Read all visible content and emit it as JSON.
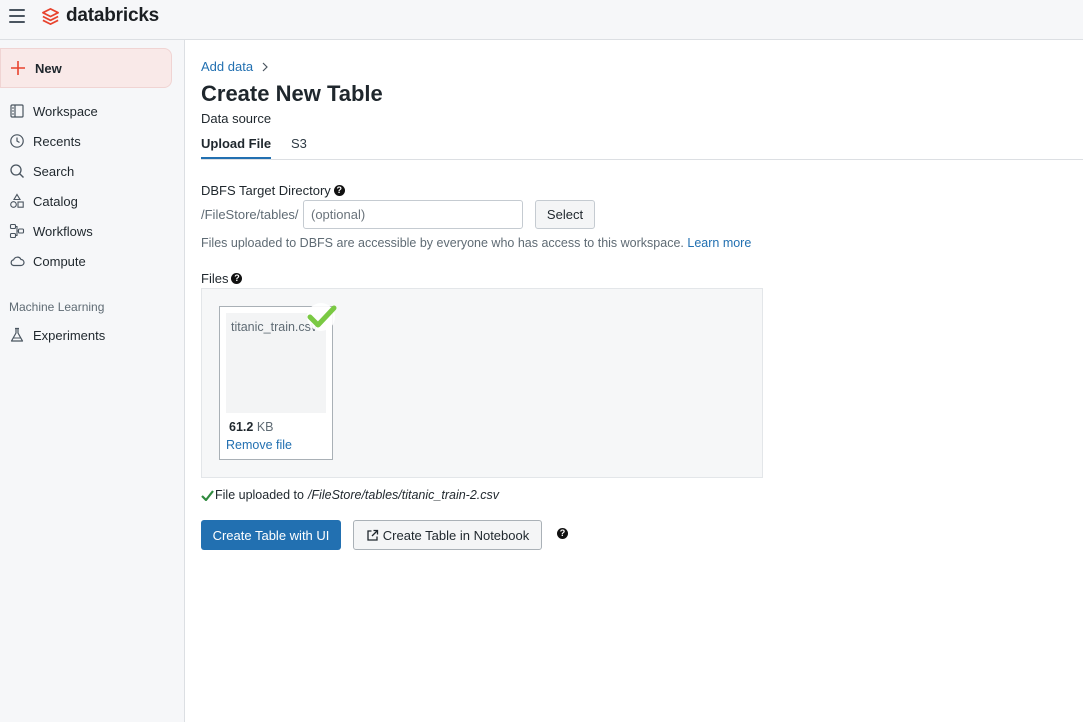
{
  "topbar": {
    "logo_text": "databricks"
  },
  "sidebar": {
    "new_label": "New",
    "items": [
      {
        "label": "Workspace",
        "icon": "workspace-icon"
      },
      {
        "label": "Recents",
        "icon": "clock-icon"
      },
      {
        "label": "Search",
        "icon": "search-icon"
      },
      {
        "label": "Catalog",
        "icon": "catalog-icon"
      },
      {
        "label": "Workflows",
        "icon": "workflows-icon"
      },
      {
        "label": "Compute",
        "icon": "cloud-icon"
      }
    ],
    "section_ml": "Machine Learning",
    "ml_items": [
      {
        "label": "Experiments",
        "icon": "flask-icon"
      }
    ]
  },
  "main": {
    "breadcrumb": "Add data",
    "title": "Create New Table",
    "data_source_label": "Data source",
    "tabs": [
      {
        "label": "Upload File",
        "active": true
      },
      {
        "label": "S3",
        "active": false
      }
    ],
    "dbfs": {
      "label": "DBFS Target Directory",
      "prefix": "/FileStore/tables/",
      "placeholder": "(optional)",
      "select_label": "Select",
      "info_text": "Files uploaded to DBFS are accessible by everyone who has access to this workspace.",
      "learn_more": "Learn more"
    },
    "files": {
      "label": "Files",
      "file_name": "titanic_train.csv",
      "size_value": "61.2",
      "size_unit": "KB",
      "remove_label": "Remove file"
    },
    "upload_status": {
      "prefix": "File uploaded to",
      "path": "/FileStore/tables/titanic_train-2.csv"
    },
    "buttons": {
      "create_ui": "Create Table with UI",
      "create_notebook": "Create Table in Notebook"
    },
    "help_glyph": "?"
  },
  "colors": {
    "accent": "#2270b1",
    "brand": "#e8432e",
    "success": "#2f8a3e",
    "check_badge": "#7ac943"
  }
}
